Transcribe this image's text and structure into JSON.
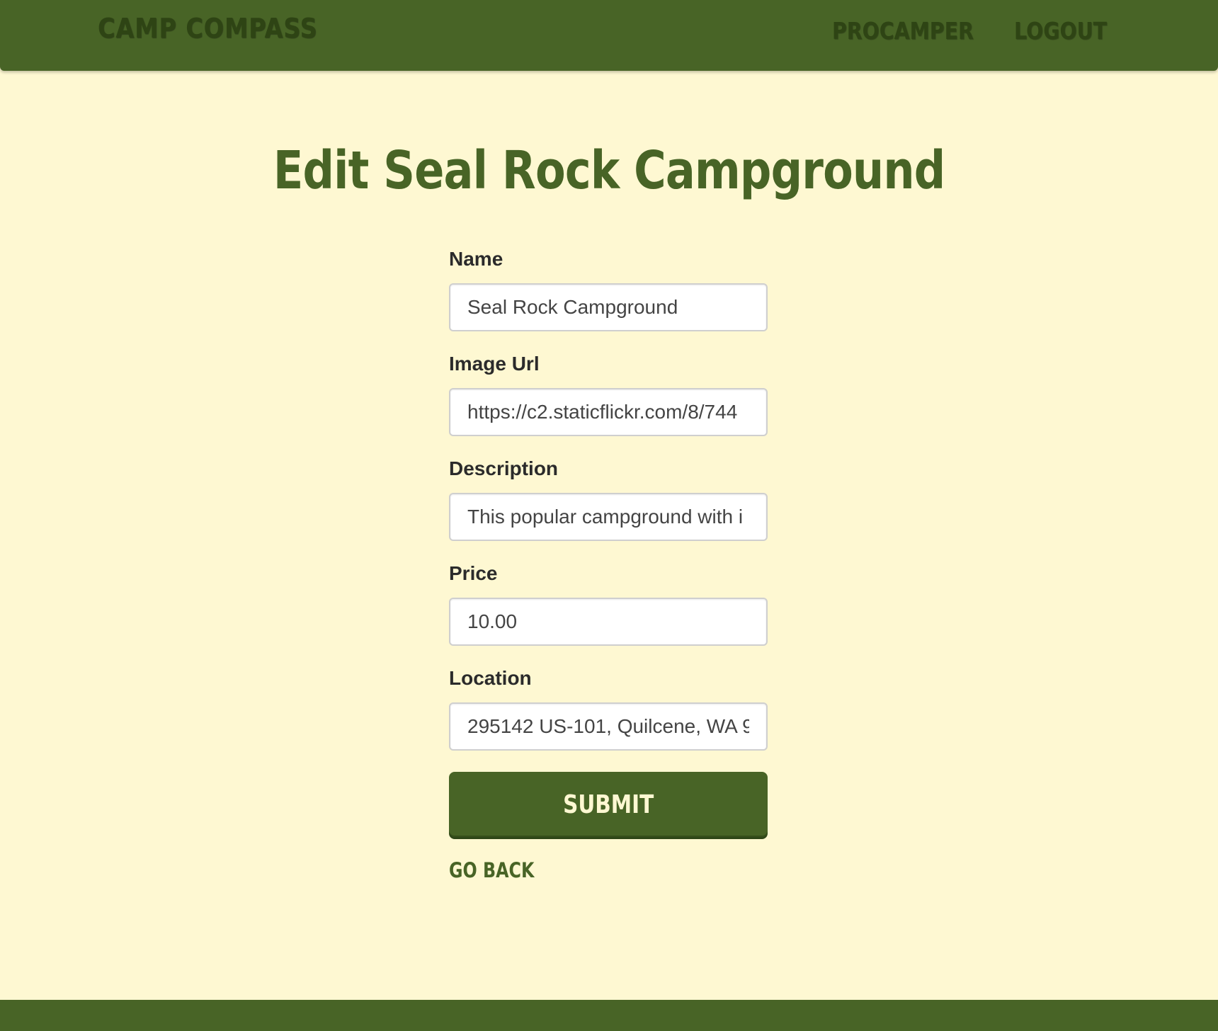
{
  "navbar": {
    "brand": "CAMP COMPASS",
    "links": [
      "PROCAMPER",
      "LOGOUT"
    ]
  },
  "page": {
    "title": "Edit Seal Rock Campground"
  },
  "form": {
    "fields": [
      {
        "label": "Name",
        "value": "Seal Rock Campground"
      },
      {
        "label": "Image Url",
        "value": "https://c2.staticflickr.com/8/744"
      },
      {
        "label": "Description",
        "value": "This popular campground with i"
      },
      {
        "label": "Price",
        "value": "10.00"
      },
      {
        "label": "Location",
        "value": "295142 US-101, Quilcene, WA 9"
      }
    ],
    "submit_label": "SUBMIT",
    "back_label": "GO BACK"
  },
  "colors": {
    "primary": "#486426",
    "dark": "#2e4414",
    "background": "#fef8d2"
  }
}
